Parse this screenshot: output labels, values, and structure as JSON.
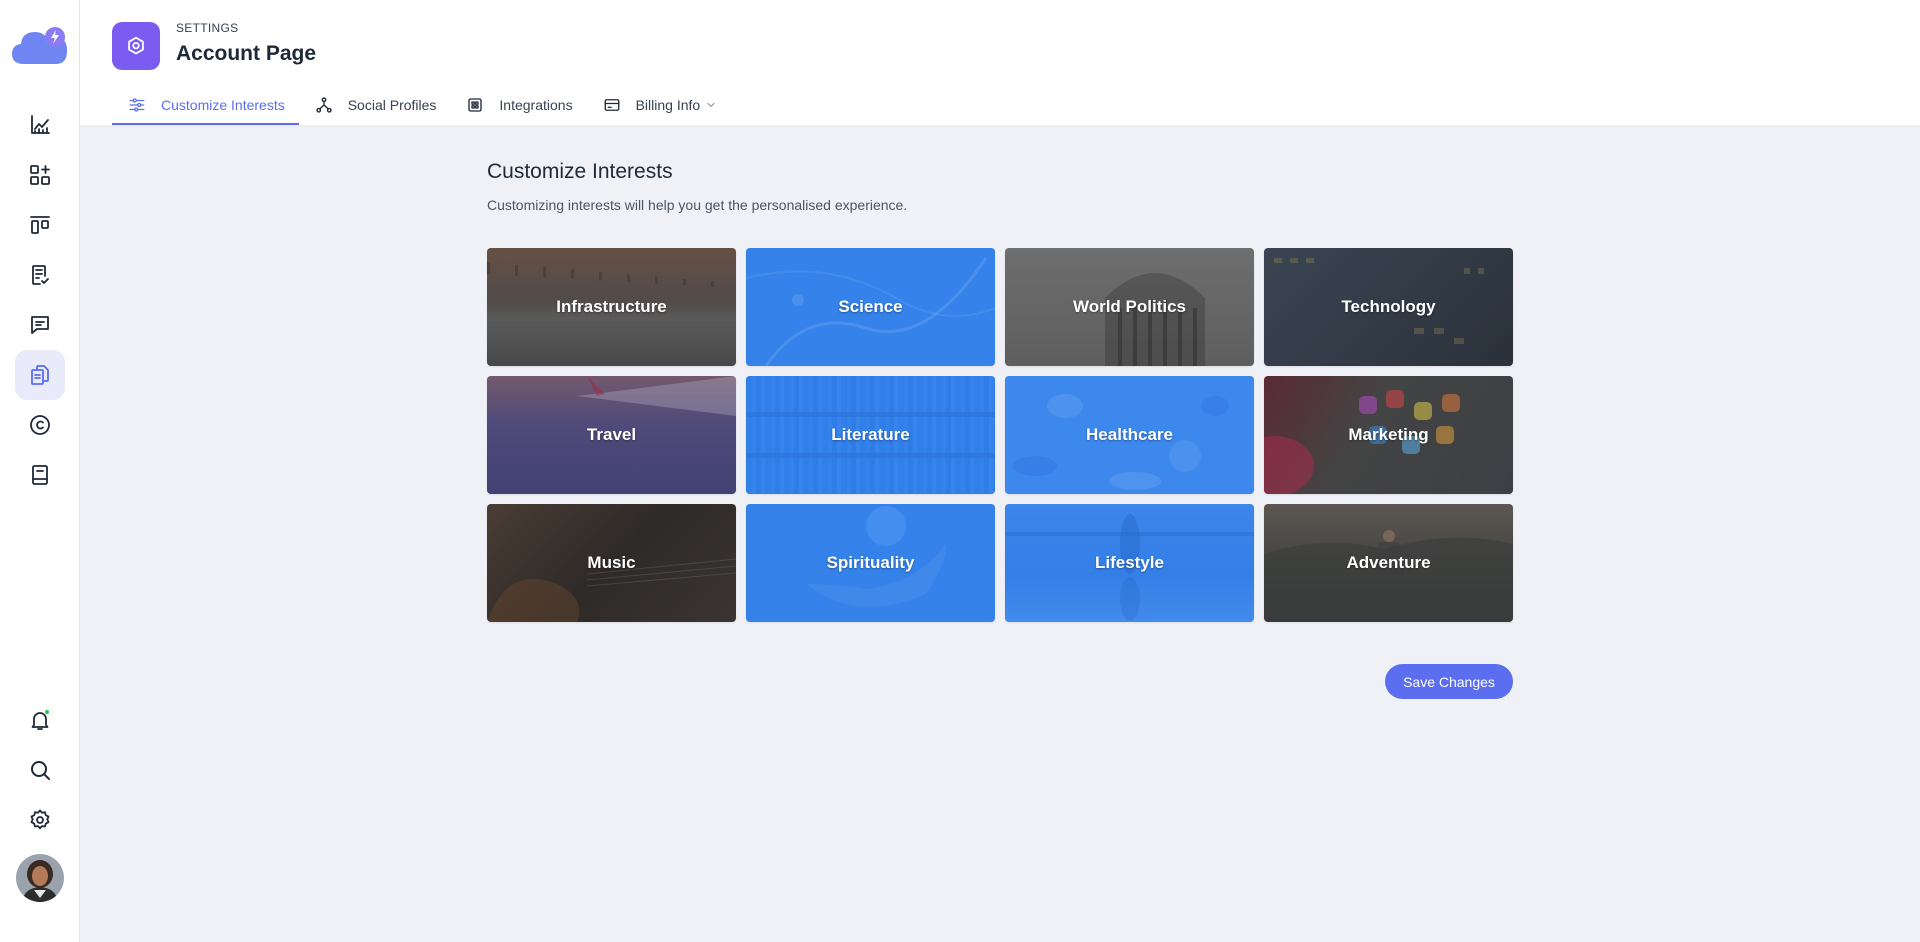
{
  "header": {
    "eyebrow": "SETTINGS",
    "title": "Account Page"
  },
  "tabs": [
    {
      "label": "Customize Interests",
      "icon": "sliders-icon",
      "active": true
    },
    {
      "label": "Social Profiles",
      "icon": "share-nodes-icon",
      "active": false
    },
    {
      "label": "Integrations",
      "icon": "integrations-icon",
      "active": false
    },
    {
      "label": "Billing Info",
      "icon": "credit-card-icon",
      "active": false,
      "dropdown": true
    }
  ],
  "sidebar": {
    "items": [
      {
        "name": "analytics-icon"
      },
      {
        "name": "apps-add-icon"
      },
      {
        "name": "kanban-icon"
      },
      {
        "name": "task-checklist-icon"
      },
      {
        "name": "chat-icon"
      },
      {
        "name": "documents-icon",
        "active": true
      },
      {
        "name": "copyright-icon"
      },
      {
        "name": "book-icon"
      }
    ],
    "bottom": [
      {
        "name": "bell-icon",
        "has_dot": true
      },
      {
        "name": "search-icon"
      },
      {
        "name": "gear-icon"
      }
    ]
  },
  "main": {
    "title": "Customize Interests",
    "subtitle": "Customizing interests will help you get the personalised experience.",
    "interests": [
      {
        "label": "Infrastructure",
        "selected": false
      },
      {
        "label": "Science",
        "selected": true
      },
      {
        "label": "World Politics",
        "selected": false
      },
      {
        "label": "Technology",
        "selected": false
      },
      {
        "label": "Travel",
        "selected": false
      },
      {
        "label": "Literature",
        "selected": true
      },
      {
        "label": "Healthcare",
        "selected": true
      },
      {
        "label": "Marketing",
        "selected": false
      },
      {
        "label": "Music",
        "selected": false
      },
      {
        "label": "Spirituality",
        "selected": true
      },
      {
        "label": "Lifestyle",
        "selected": true
      },
      {
        "label": "Adventure",
        "selected": false
      }
    ],
    "save_label": "Save Changes"
  },
  "colors": {
    "accent": "#5b6ef0",
    "brand_purple": "#7b5cf0",
    "selected_overlay": "#2f80ed",
    "notification_dot": "#22c55e"
  }
}
